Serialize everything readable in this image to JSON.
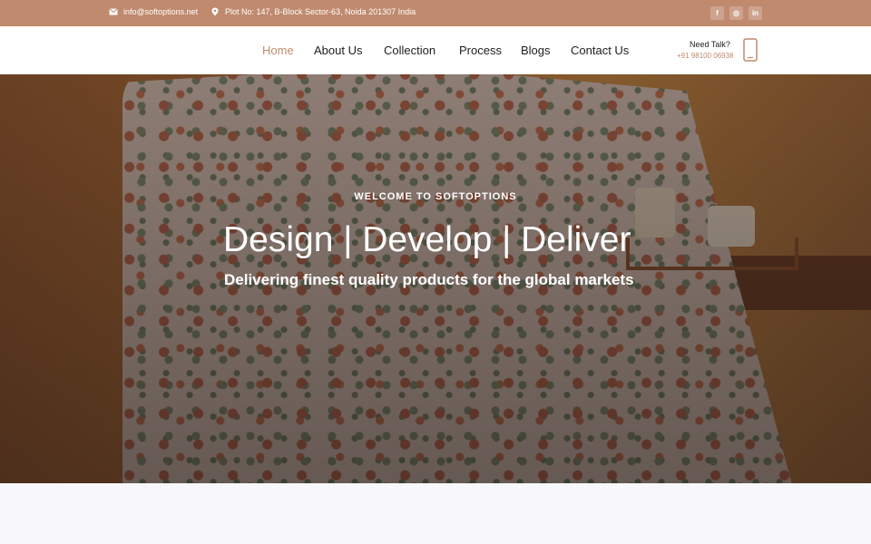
{
  "topbar": {
    "email": "info@softoptions.net",
    "address": "Plot No: 147, B-Block Sector-63, Noida 201307 India",
    "social": [
      {
        "icon": "facebook-icon",
        "glyph": "f"
      },
      {
        "icon": "instagram-icon",
        "glyph": "◎"
      },
      {
        "icon": "linkedin-icon",
        "glyph": "in"
      }
    ]
  },
  "nav": {
    "items": [
      "Home",
      "About Us",
      "Collection",
      "Process",
      "Blogs",
      "Contact Us"
    ],
    "active": "Home"
  },
  "contact": {
    "label": "Need Talk?",
    "phone": "+91 98100 06938"
  },
  "hero": {
    "kicker": "WELCOME TO SOFTOPTIONS",
    "title": "Design | Develop | Deliver",
    "subtitle": "Delivering finest quality products for the global markets"
  },
  "colors": {
    "accent": "#c08a6e",
    "topbar_bg": "#c08a6e",
    "text_dark": "#1e1e1e"
  }
}
